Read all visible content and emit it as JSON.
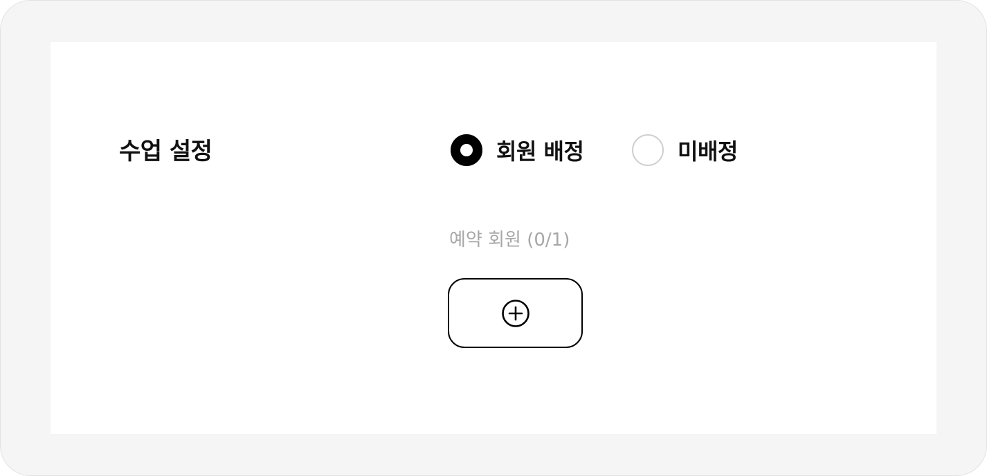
{
  "class_setting": {
    "title": "수업 설정",
    "options": [
      {
        "label": "회원 배정",
        "selected": true
      },
      {
        "label": "미배정",
        "selected": false
      }
    ]
  },
  "reservation": {
    "label": "예약 회원 (0/1)",
    "add_icon": "plus-circle-icon"
  }
}
